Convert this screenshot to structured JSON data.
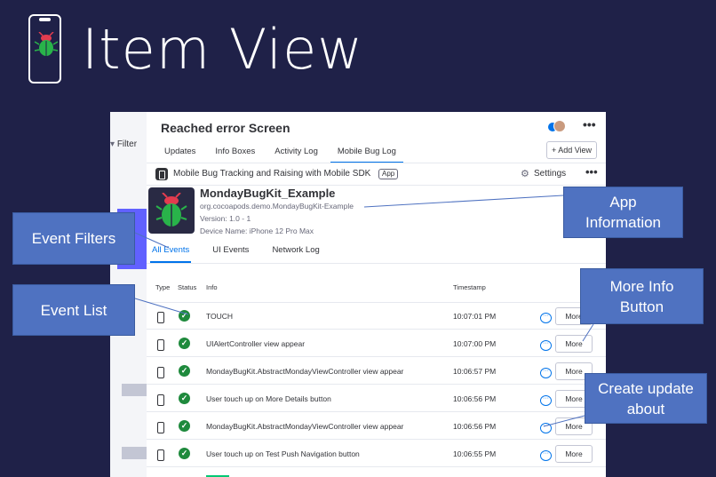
{
  "slide": {
    "title": "Item View"
  },
  "background_board": {
    "filter_label": "Filter"
  },
  "item": {
    "title": "Reached error Screen",
    "more_glyph": "•••",
    "tabs": [
      {
        "label": "Updates"
      },
      {
        "label": "Info Boxes"
      },
      {
        "label": "Activity Log"
      },
      {
        "label": "Mobile Bug Log",
        "active": true
      }
    ],
    "add_view_label": "+ Add View"
  },
  "app_bar": {
    "name": "Mobile Bug Tracking and Raising with Mobile SDK",
    "badge": "App",
    "settings_label": "Settings",
    "more_glyph": "•••"
  },
  "app_info": {
    "name": "MondayBugKit_Example",
    "bundle": "org.cocoapods.demo.MondayBugKit-Example",
    "version": "Version: 1.0 - 1",
    "device": "Device Name: iPhone 12 Pro Max"
  },
  "event_tabs": [
    {
      "label": "All Events",
      "active": true
    },
    {
      "label": "UI Events"
    },
    {
      "label": "Network Log"
    }
  ],
  "table": {
    "headers": {
      "type": "Type",
      "status": "Status",
      "info": "Info",
      "timestamp": "Timestamp"
    },
    "rows": [
      {
        "info": "TOUCH",
        "timestamp": "10:07:01 PM",
        "button": "More"
      },
      {
        "info": "UIAlertController view appear",
        "timestamp": "10:07:00 PM",
        "button": "More"
      },
      {
        "info": "MondayBugKit.AbstractMondayViewController view appear",
        "timestamp": "10:06:57 PM",
        "button": "More"
      },
      {
        "info": "User touch up on More Details button",
        "timestamp": "10:06:56 PM",
        "button": "More"
      },
      {
        "info": "MondayBugKit.AbstractMondayViewController view appear",
        "timestamp": "10:06:56 PM",
        "button": "More"
      },
      {
        "info": "User touch up on Test Push Navigation button",
        "timestamp": "10:06:55 PM",
        "button": "More"
      }
    ]
  },
  "callouts": {
    "event_filters": "Event Filters",
    "event_list": "Event List",
    "app_information_line1": "App",
    "app_information_line2": "Information",
    "more_info_line1": "More Info",
    "more_info_line2": "Button",
    "create_update_line1": "Create update",
    "create_update_line2": "about"
  },
  "colors": {
    "slide_background": "#1f2148",
    "callout": "#4f72c1",
    "accent_blue": "#0073ea",
    "status_green": "#1f8a3d"
  },
  "icons": {
    "app_logo": "bug-icon",
    "status": "check-circle-icon",
    "type": "phone-icon",
    "update": "chat-bubble-icon",
    "settings": "gear-icon"
  }
}
